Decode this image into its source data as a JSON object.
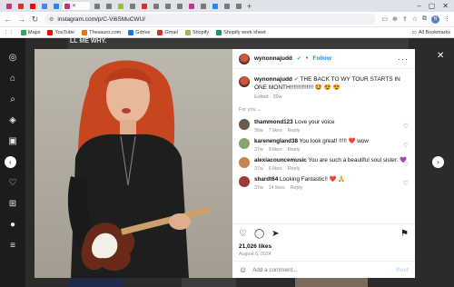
{
  "browser": {
    "tabs": [
      {
        "icon": "instagram-icon",
        "color": "#c13584",
        "label": "",
        "active": false
      },
      {
        "icon": "gmail-icon",
        "color": "#d93025",
        "label": "",
        "active": false
      },
      {
        "icon": "youtube-icon",
        "color": "#ff0000",
        "label": "",
        "active": false
      },
      {
        "icon": "google-icon",
        "color": "#4285f4",
        "label": "",
        "active": false
      },
      {
        "icon": "docs-icon",
        "color": "#2684fc",
        "label": "",
        "active": false
      },
      {
        "icon": "instagram-icon",
        "color": "#c13584",
        "label": "",
        "active": true
      },
      {
        "icon": "site-icon",
        "color": "#7a7a7a",
        "label": "",
        "active": false
      },
      {
        "icon": "site-icon",
        "color": "#7a7a7a",
        "label": "",
        "active": false
      },
      {
        "icon": "shopify-icon",
        "color": "#95bf47",
        "label": "",
        "active": false
      },
      {
        "icon": "site-icon",
        "color": "#7a7a7a",
        "label": "",
        "active": false
      },
      {
        "icon": "gmail-icon",
        "color": "#d93025",
        "label": "",
        "active": false
      },
      {
        "icon": "site-icon",
        "color": "#7a7a7a",
        "label": "",
        "active": false
      },
      {
        "icon": "site-icon",
        "color": "#7a7a7a",
        "label": "",
        "active": false
      },
      {
        "icon": "site-icon",
        "color": "#7a7a7a",
        "label": "",
        "active": false
      },
      {
        "icon": "instagram-icon",
        "color": "#c13584",
        "label": "",
        "active": false
      },
      {
        "icon": "site-icon",
        "color": "#7a7a7a",
        "label": "",
        "active": false
      },
      {
        "icon": "docs-icon",
        "color": "#2684fc",
        "label": "",
        "active": false
      },
      {
        "icon": "site-icon",
        "color": "#7a7a7a",
        "label": "",
        "active": false
      },
      {
        "icon": "site-icon",
        "color": "#7a7a7a",
        "label": "",
        "active": false
      }
    ],
    "url": "instagram.com/p/C-Vi6SMuCWU/",
    "bookmarks": [
      {
        "label": "Maps",
        "color": "#34a853"
      },
      {
        "label": "YouTube",
        "color": "#ff0000"
      },
      {
        "label": "Thesauro.com",
        "color": "#e37400"
      },
      {
        "label": "Gdrive",
        "color": "#1a73e8"
      },
      {
        "label": "Gmail",
        "color": "#d93025"
      },
      {
        "label": "Shopify",
        "color": "#95bf47"
      },
      {
        "label": "Shopify work sheet",
        "color": "#0f9d58"
      }
    ],
    "all_bookmarks": "All Bookmarks",
    "profile_initial": "N"
  },
  "page": {
    "top_strip": "LL ME WHY."
  },
  "post": {
    "username": "wynonnajudd",
    "follow": "Follow",
    "caption": "THE BACK TO WY TOUR STARTS IN ONE MONTH!!!!!!!!!!!!!! 🤩 😍 😍",
    "caption_meta": "Edited · 39w",
    "for_you": "For you ⌄",
    "comments": [
      {
        "user": "thammond123",
        "text": "Love your voice",
        "time": "36w",
        "likes": "7 likes",
        "reply": "Reply",
        "avatar": "#6b5a4a"
      },
      {
        "user": "karenengland38",
        "text": "You look great! !!!!! ❤️ wow",
        "time": "37w",
        "likes": "9 likes",
        "reply": "Reply",
        "avatar": "#8aa36b"
      },
      {
        "user": "alexiacouncemusic",
        "text": "You are such a beautiful soul sister. 💜",
        "time": "37w",
        "likes": "6 likes",
        "reply": "Reply",
        "avatar": "#c8824a"
      },
      {
        "user": "shardt64",
        "text": "Looking Fantastic!! ❤️ 🙏",
        "time": "37w",
        "likes": "14 likes",
        "reply": "Reply",
        "avatar": "#a03a3a"
      }
    ],
    "likes": "21,026 likes",
    "date": "August 6, 2024",
    "add_comment_placeholder": "Add a comment...",
    "post_label": "Post"
  }
}
